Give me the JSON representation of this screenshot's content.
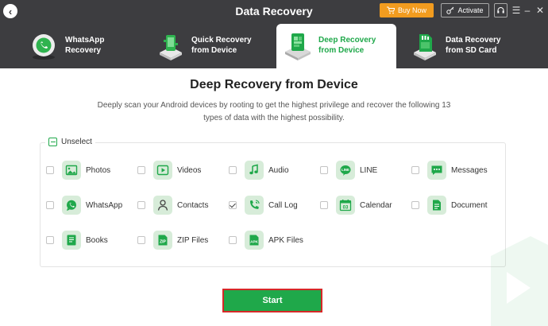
{
  "window": {
    "title": "Data Recovery",
    "buy_label": "Buy Now",
    "activate_label": "Activate",
    "controls": [
      "support-icon",
      "menu-icon",
      "minimize-icon",
      "close-icon"
    ]
  },
  "tabs": [
    {
      "label": "WhatsApp\nRecovery",
      "icon": "whatsapp-recovery-icon",
      "active": false
    },
    {
      "label": "Quick Recovery\nfrom Device",
      "icon": "quick-recovery-icon",
      "active": false
    },
    {
      "label": "Deep Recovery\nfrom Device",
      "icon": "deep-recovery-icon",
      "active": true
    },
    {
      "label": "Data Recovery\nfrom SD Card",
      "icon": "sd-card-icon",
      "active": false
    }
  ],
  "main": {
    "title": "Deep Recovery from Device",
    "description": "Deeply scan your Android devices by rooting to get the highest privilege and recover the following 13 types of data with the highest possibility.",
    "unselect_label": "Unselect",
    "start_label": "Start"
  },
  "data_types": [
    {
      "label": "Photos",
      "icon": "photos-icon",
      "checked": false
    },
    {
      "label": "Videos",
      "icon": "videos-icon",
      "checked": false
    },
    {
      "label": "Audio",
      "icon": "audio-icon",
      "checked": false
    },
    {
      "label": "LINE",
      "icon": "line-icon",
      "checked": false
    },
    {
      "label": "Messages",
      "icon": "messages-icon",
      "checked": false
    },
    {
      "label": "WhatsApp",
      "icon": "whatsapp-icon",
      "checked": false
    },
    {
      "label": "Contacts",
      "icon": "contacts-icon",
      "checked": false
    },
    {
      "label": "Call Log",
      "icon": "call-log-icon",
      "checked": true
    },
    {
      "label": "Calendar",
      "icon": "calendar-icon",
      "checked": false
    },
    {
      "label": "Document",
      "icon": "document-icon",
      "checked": false
    },
    {
      "label": "Books",
      "icon": "books-icon",
      "checked": false
    },
    {
      "label": "ZIP Files",
      "icon": "zip-files-icon",
      "checked": false
    },
    {
      "label": "APK Files",
      "icon": "apk-files-icon",
      "checked": false
    }
  ],
  "colors": {
    "accent": "#1fa84a",
    "titlebar": "#3d3d40",
    "buy": "#f29c1f",
    "highlight": "#d62828"
  }
}
